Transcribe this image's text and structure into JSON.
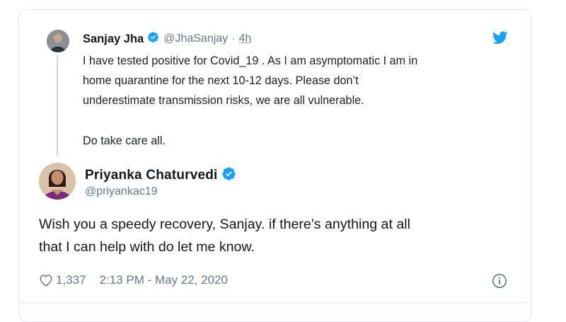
{
  "original_tweet": {
    "display_name": "Sanjay Jha",
    "handle": "@JhaSanjay",
    "separator": "·",
    "time_ago": "4h",
    "text_lines": [
      "I have tested positive for Covid_19 . As I am asymptomatic I am in",
      "home quarantine for the next 10-12 days. Please don’t",
      "underestimate transmission risks, we are all vulnerable."
    ],
    "closing_line": "Do take care all."
  },
  "reply_tweet": {
    "display_name": "Priyanka Chaturvedi",
    "handle": "@priyankac19",
    "text_lines": [
      "Wish you a speedy recovery, Sanjay. if there’s anything at all",
      "that I can help with do let me know."
    ],
    "like_count": "1,337",
    "timestamp": "2:13 PM - May 22, 2020"
  },
  "icons": {
    "verified": "verified-badge-icon",
    "twitter": "twitter-bird-icon",
    "like": "heart-icon",
    "info": "info-icon"
  },
  "colors": {
    "verified_blue": "#1da1f2",
    "secondary_text": "#657786",
    "border": "#e1e8ed"
  }
}
